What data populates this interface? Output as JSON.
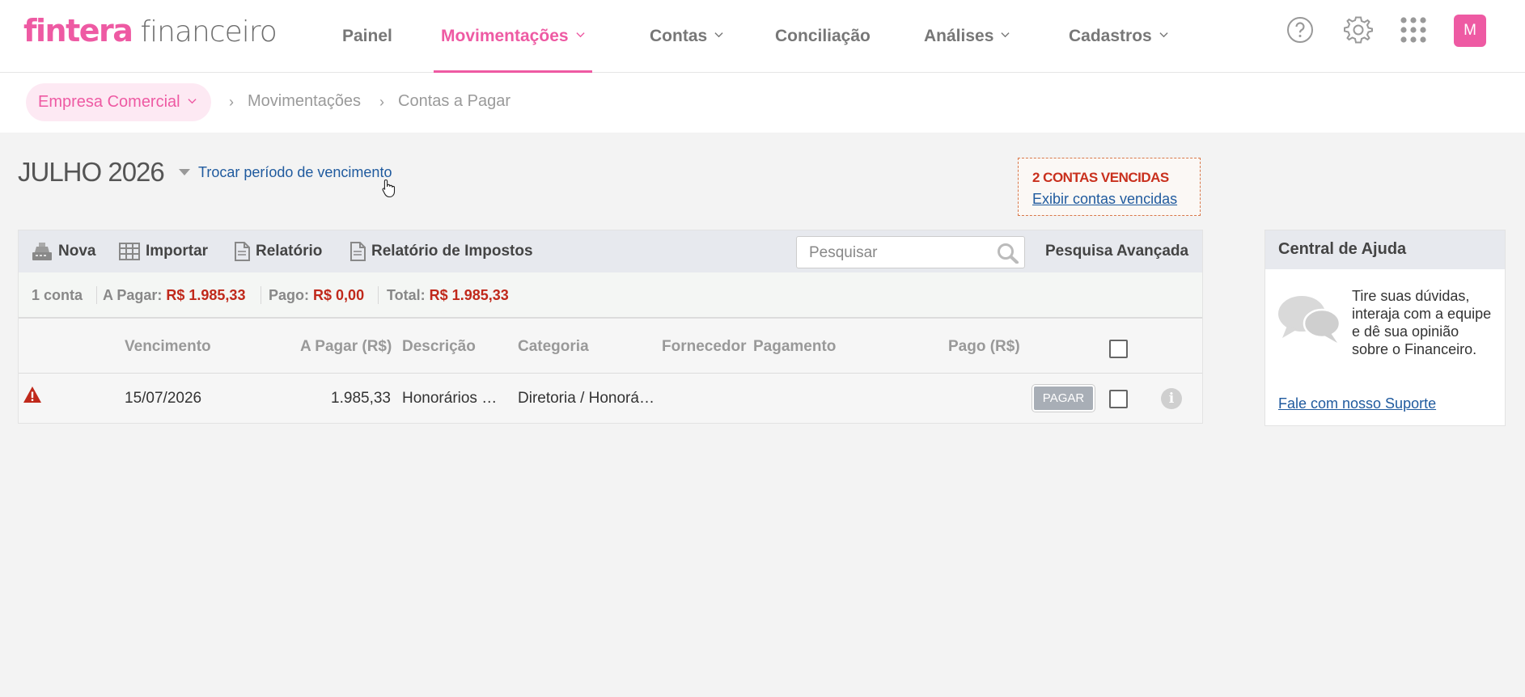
{
  "app": {
    "brand": "fintera",
    "product": "financeiro",
    "accent_color": "#ee5aa3"
  },
  "nav": {
    "items": [
      {
        "label": "Painel",
        "active": false,
        "has_menu": false
      },
      {
        "label": "Movimentações",
        "active": true,
        "has_menu": true
      },
      {
        "label": "Contas",
        "active": false,
        "has_menu": true
      },
      {
        "label": "Conciliação",
        "active": false,
        "has_menu": false
      },
      {
        "label": "Análises",
        "active": false,
        "has_menu": true
      },
      {
        "label": "Cadastros",
        "active": false,
        "has_menu": true
      }
    ],
    "icons": [
      "help-icon",
      "gear-icon",
      "apps-grid-icon"
    ],
    "avatar_initial": "M"
  },
  "breadcrumb": {
    "company": "Empresa Comercial",
    "items": [
      "Movimentações",
      "Contas a Pagar"
    ]
  },
  "period": {
    "title": "JULHO 2026",
    "change_link": "Trocar período de vencimento"
  },
  "overdue": {
    "title": "2 CONTAS VENCIDAS",
    "link": "Exibir contas vencidas",
    "color": "#c9301d"
  },
  "toolbar": {
    "new_label": "Nova",
    "import_label": "Importar",
    "report_label": "Relatório",
    "tax_report_label": "Relatório de Impostos",
    "search_placeholder": "Pesquisar",
    "advanced_search_label": "Pesquisa Avançada"
  },
  "summary": {
    "count": "1 conta",
    "to_pay_label": "A Pagar:",
    "to_pay_value": "R$ 1.985,33",
    "paid_label": "Pago:",
    "paid_value": "R$ 0,00",
    "total_label": "Total:",
    "total_value": "R$ 1.985,33"
  },
  "table": {
    "headers": {
      "due": "Vencimento",
      "to_pay": "A Pagar (R$)",
      "description": "Descrição",
      "category": "Categoria",
      "supplier": "Fornecedor",
      "payment": "Pagamento",
      "paid": "Pago (R$)"
    },
    "rows": [
      {
        "status": "overdue",
        "due": "15/07/2026",
        "to_pay": "1.985,33",
        "description": "Honorários …",
        "category": "Diretoria / Honorá…",
        "supplier": "",
        "payment": "",
        "paid": "",
        "action": "PAGAR",
        "checked": false
      }
    ]
  },
  "help": {
    "title": "Central de Ajuda",
    "text": "Tire suas dúvidas, interaja com a equipe e dê sua opinião sobre o Financeiro.",
    "link": "Fale com nosso Suporte"
  }
}
